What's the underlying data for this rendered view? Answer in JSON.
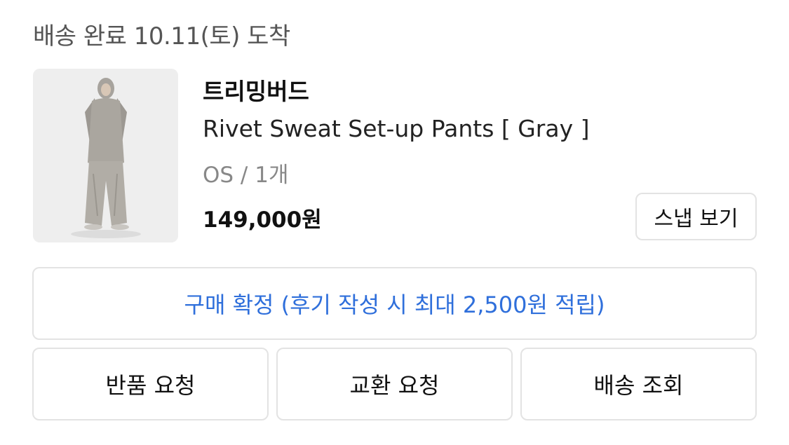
{
  "delivery": {
    "status_text": "배송 완료 10.11(토) 도착"
  },
  "product": {
    "image_alt": "product-photo",
    "brand": "트리밍버드",
    "title": "Rivet Sweat Set-up Pants [ Gray ]",
    "option": "OS / 1개",
    "price": "149,000원"
  },
  "buttons": {
    "snap": "스냅 보기",
    "confirm": "구매 확정 (후기 작성 시 최대 2,500원 적립)",
    "return": "반품 요청",
    "exchange": "교환 요청",
    "tracking": "배송 조회"
  },
  "colors": {
    "accent_blue": "#2f6fdb",
    "border": "#e3e3e3",
    "muted_text": "#888888"
  }
}
